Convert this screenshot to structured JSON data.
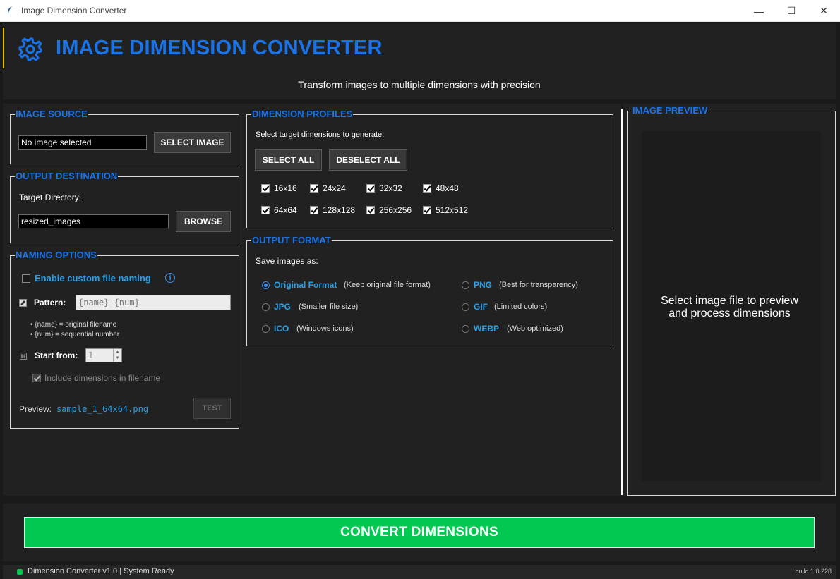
{
  "window": {
    "title": "Image Dimension Converter",
    "minimize": "—",
    "maximize": "☐",
    "close": "✕"
  },
  "header": {
    "title": "IMAGE DIMENSION CONVERTER",
    "subtitle": "Transform images to multiple dimensions with precision",
    "accent_color": "#1a73e8"
  },
  "image_source": {
    "legend": "IMAGE SOURCE",
    "path_value": "No image selected",
    "select_button": "SELECT IMAGE"
  },
  "output_destination": {
    "legend": "OUTPUT DESTINATION",
    "target_label": "Target Directory:",
    "path_value": "resized_images",
    "browse_button": "BROWSE"
  },
  "naming": {
    "legend": "NAMING OPTIONS",
    "enable_label": "Enable custom file naming",
    "enable_checked": false,
    "pattern_label": "Pattern:",
    "pattern_placeholder": "{name}_{num}",
    "hint_name": "• {name} = original filename",
    "hint_num": "• {num} = sequential number",
    "start_label": "Start from:",
    "start_value": "1",
    "include_dims_label": "Include dimensions in filename",
    "include_dims_checked": true,
    "preview_label": "Preview:",
    "preview_value": "sample_1_64x64.png",
    "test_button": "TEST"
  },
  "dimension_profiles": {
    "legend": "DIMENSION PROFILES",
    "instruction": "Select target dimensions to generate:",
    "select_all": "SELECT ALL",
    "deselect_all": "DESELECT ALL",
    "sizes": [
      "16x16",
      "24x24",
      "32x32",
      "48x48",
      "64x64",
      "128x128",
      "256x256",
      "512x512"
    ],
    "checked": [
      true,
      true,
      true,
      true,
      true,
      true,
      true,
      true
    ]
  },
  "output_format": {
    "legend": "OUTPUT FORMAT",
    "label": "Save images as:",
    "options": [
      {
        "name": "Original Format",
        "desc": "(Keep original file format)",
        "selected": true
      },
      {
        "name": "PNG",
        "desc": "(Best for transparency)",
        "selected": false
      },
      {
        "name": "JPG",
        "desc": "(Smaller file size)",
        "selected": false
      },
      {
        "name": "GIF",
        "desc": "(Limited colors)",
        "selected": false
      },
      {
        "name": "ICO",
        "desc": "(Windows icons)",
        "selected": false
      },
      {
        "name": "WEBP",
        "desc": "(Web optimized)",
        "selected": false
      }
    ]
  },
  "image_preview": {
    "legend": "IMAGE PREVIEW",
    "line1": "Select image file to preview",
    "line2": "and process dimensions"
  },
  "convert_button": "CONVERT DIMENSIONS",
  "status": {
    "text": "Dimension Converter v1.0 | System Ready",
    "build": "build 1.0.228"
  },
  "icons": {
    "app": "feather-icon",
    "header": "gear-icon",
    "info": "info-icon",
    "pattern": "edit-icon",
    "start": "counter-icon"
  },
  "colors": {
    "convert": "#00c851",
    "legend": "#1a73e8",
    "format_name": "#2aa0e8"
  }
}
